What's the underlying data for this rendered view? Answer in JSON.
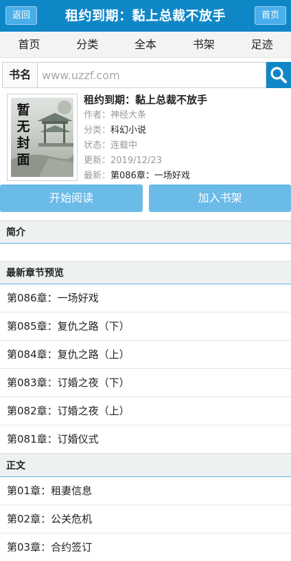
{
  "header": {
    "back_label": "返回",
    "title": "租约到期：黏上总裁不放手",
    "home_label": "首页"
  },
  "nav": [
    "首页",
    "分类",
    "全本",
    "书架",
    "足迹"
  ],
  "search": {
    "label": "书名",
    "placeholder": "www.uzzf.com"
  },
  "book": {
    "cover_text": "暂无封面",
    "title": "租约到期：黏上总裁不放手",
    "author_key": "作者：",
    "author": "神经大条",
    "category_key": "分类：",
    "category": "科幻小说",
    "status_key": "状态：",
    "status": "连载中",
    "updated_key": "更新：",
    "updated": "2019/12/23",
    "latest_key": "最新：",
    "latest": "第086章：一场好戏"
  },
  "actions": {
    "read_label": "开始阅读",
    "shelf_label": "加入书架"
  },
  "sections": {
    "intro": "简介",
    "latest": "最新章节预览",
    "body": "正文"
  },
  "latest_chapters": [
    "第086章：一场好戏",
    "第085章：复仇之路（下）",
    "第084章：复仇之路（上）",
    "第083章：订婚之夜（下）",
    "第082章：订婚之夜（上）",
    "第081章：订婚仪式"
  ],
  "body_chapters": [
    "第01章：租妻信息",
    "第02章：公关危机",
    "第03章：合约签订"
  ],
  "colors": {
    "brand": "#0f87c7",
    "button": "#6bbbe8",
    "section_bg": "#eef1f2"
  }
}
